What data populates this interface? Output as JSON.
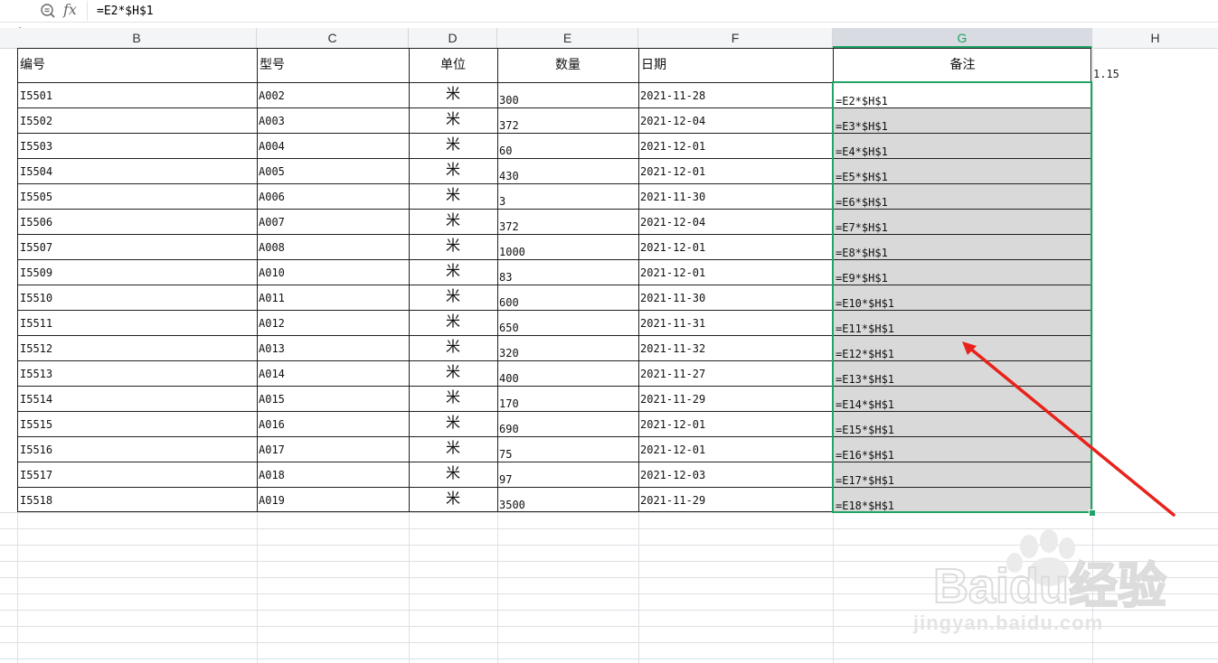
{
  "formula_bar": {
    "formula": "=E2*$H$1"
  },
  "columns": [
    "B",
    "C",
    "D",
    "E",
    "F",
    "G",
    "H"
  ],
  "selected_column": "G",
  "headers": {
    "B": "编号",
    "C": "型号",
    "D": "单位",
    "E": "数量",
    "F": "日期",
    "G": "备注"
  },
  "h1_value": "1.15",
  "rows": [
    {
      "id": "I5501",
      "model": "A002",
      "unit": "米",
      "qty": "300",
      "date": "2021-11-28",
      "note": "=E2*$H$1"
    },
    {
      "id": "I5502",
      "model": "A003",
      "unit": "米",
      "qty": "372",
      "date": "2021-12-04",
      "note": "=E3*$H$1"
    },
    {
      "id": "I5503",
      "model": "A004",
      "unit": "米",
      "qty": "60",
      "date": "2021-12-01",
      "note": "=E4*$H$1"
    },
    {
      "id": "I5504",
      "model": "A005",
      "unit": "米",
      "qty": "430",
      "date": "2021-12-01",
      "note": "=E5*$H$1"
    },
    {
      "id": "I5505",
      "model": "A006",
      "unit": "米",
      "qty": "3",
      "date": "2021-11-30",
      "note": "=E6*$H$1"
    },
    {
      "id": "I5506",
      "model": "A007",
      "unit": "米",
      "qty": "372",
      "date": "2021-12-04",
      "note": "=E7*$H$1"
    },
    {
      "id": "I5507",
      "model": "A008",
      "unit": "米",
      "qty": "1000",
      "date": "2021-12-01",
      "note": "=E8*$H$1"
    },
    {
      "id": "I5509",
      "model": "A010",
      "unit": "米",
      "qty": "83",
      "date": "2021-12-01",
      "note": "=E9*$H$1"
    },
    {
      "id": "I5510",
      "model": "A011",
      "unit": "米",
      "qty": "600",
      "date": "2021-11-30",
      "note": "=E10*$H$1"
    },
    {
      "id": "I5511",
      "model": "A012",
      "unit": "米",
      "qty": "650",
      "date": "2021-11-31",
      "note": "=E11*$H$1"
    },
    {
      "id": "I5512",
      "model": "A013",
      "unit": "米",
      "qty": "320",
      "date": "2021-11-32",
      "note": "=E12*$H$1"
    },
    {
      "id": "I5513",
      "model": "A014",
      "unit": "米",
      "qty": "400",
      "date": "2021-11-27",
      "note": "=E13*$H$1"
    },
    {
      "id": "I5514",
      "model": "A015",
      "unit": "米",
      "qty": "170",
      "date": "2021-11-29",
      "note": "=E14*$H$1"
    },
    {
      "id": "I5515",
      "model": "A016",
      "unit": "米",
      "qty": "690",
      "date": "2021-12-01",
      "note": "=E15*$H$1"
    },
    {
      "id": "I5516",
      "model": "A017",
      "unit": "米",
      "qty": "75",
      "date": "2021-12-01",
      "note": "=E16*$H$1"
    },
    {
      "id": "I5517",
      "model": "A018",
      "unit": "米",
      "qty": "97",
      "date": "2021-12-03",
      "note": "=E17*$H$1"
    },
    {
      "id": "I5518",
      "model": "A019",
      "unit": "米",
      "qty": "3500",
      "date": "2021-11-29",
      "note": "=E18*$H$1"
    }
  ],
  "colors": {
    "accent": "#21a366",
    "selection_fill": "#d9d9d9",
    "annotation_arrow": "#e8221b"
  },
  "watermark": {
    "brand": "Baidu经验",
    "url": "jingyan.baidu.com"
  }
}
